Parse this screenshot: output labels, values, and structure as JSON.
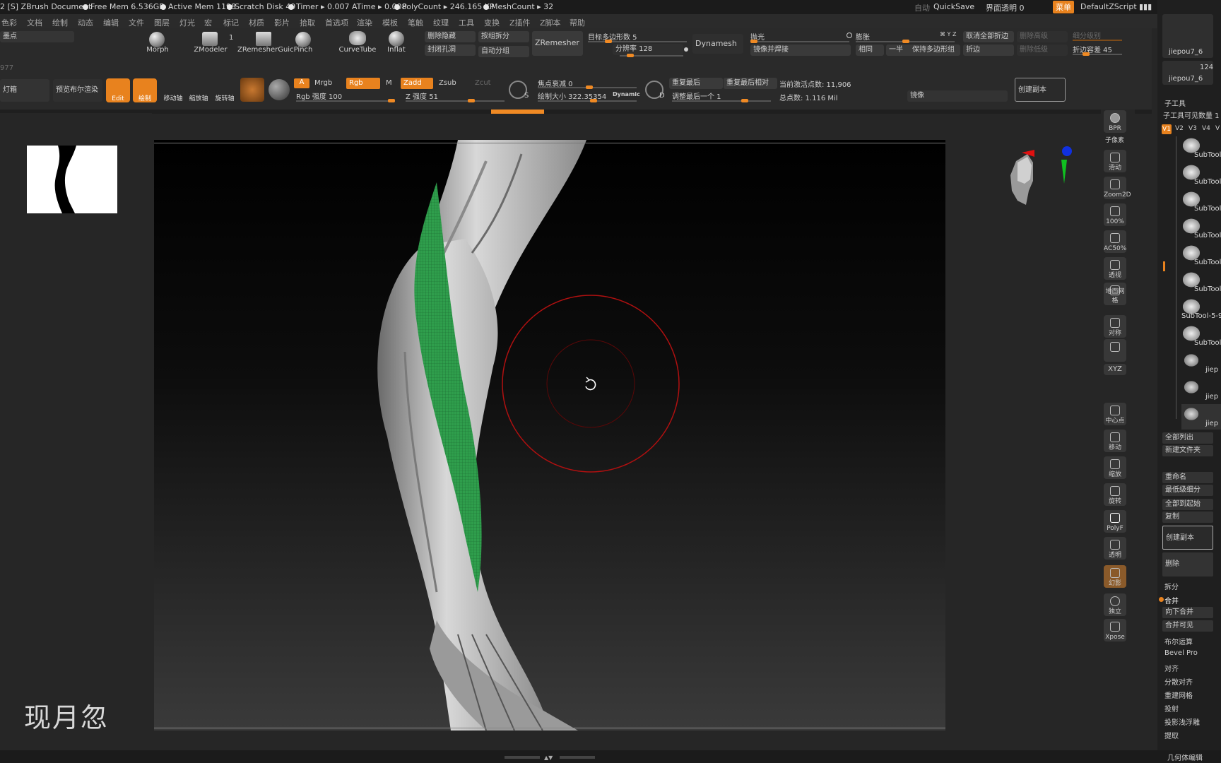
{
  "titlebar": {
    "left": "2 [S]  ZBrush Document",
    "free_mem": "Free Mem 6.536GB",
    "active_mem": "Active Mem 1198",
    "scratch": "Scratch Disk 49",
    "timer": "Timer ▸ 0.007 ATime ▸ 0.008",
    "polycount": "PolyCount ▸ 246.165 KP",
    "meshcount": "MeshCount ▸ 32",
    "auto": "自动",
    "quicksave": "QuickSave",
    "ui_opacity": "界面透明 0",
    "menu": "菜单",
    "script": "DefaultZScript"
  },
  "menus": [
    "色彩",
    "文档",
    "绘制",
    "动态",
    "编辑",
    "文件",
    "图层",
    "灯光",
    "宏",
    "标记",
    "材质",
    "影片",
    "拾取",
    "首选项",
    "渲染",
    "模板",
    "笔触",
    "纹理",
    "工具",
    "变换",
    "Z插件",
    "Z脚本",
    "帮助"
  ],
  "toolbar": {
    "moxdian": "墨点",
    "num977": "977",
    "lightbox": "灯箱",
    "preview_bool": "预览布尔渲染",
    "brushes": [
      "Morph",
      "ZModeler",
      "ZRemesherGuic",
      "Pinch",
      "CurveTube",
      "Inflat"
    ],
    "zmodeler_count": "1",
    "del_hidden": "删除隐藏",
    "close_holes": "封闭孔洞",
    "group_split": "按组拆分",
    "auto_group": "自动分组",
    "zremesher": "ZRemesher",
    "target_poly": "目标多边形数 5",
    "resolution": "分辨率 128",
    "dynamesh": "Dynamesh",
    "polish": "抛光",
    "inflate": "膨胀",
    "xyz": "⌘ Y Z",
    "cancel_all_fold": "取消全部折边",
    "del_higher": "删除高级",
    "subdiv_level": "细分级别",
    "mirror_weld": "镜像并焊接",
    "same": "相同",
    "half": "一半",
    "keep_groups": "保持多边形组",
    "crease": "折边",
    "del_lower": "删除低级",
    "crease_tol": "折边容差 45",
    "edit": "Edit",
    "draw": "绘制",
    "move": "移动轴",
    "scale": "缩放轴",
    "rotate": "旋转轴",
    "a": "A",
    "mrgb": "Mrgb",
    "rgb": "Rgb",
    "m": "M",
    "zadd": "Zadd",
    "zsub": "Zsub",
    "zcut": "Zcut",
    "rgb_intensity": "Rgb 强度 100",
    "z_intensity": "Z 强度 51",
    "focal": "焦点衰减 0",
    "draw_size": "绘制大小 322.35354",
    "dynamic": "Dynamic",
    "redo_last": "重复最后",
    "redo_last_rel": "重复最后相对",
    "adjust_last": "调整最后一个 1",
    "active_points": "当前激活点数: 11,906",
    "total_points": "总点数: 1.116 Mil",
    "mirror": "镜像",
    "create_copy": "创建副本",
    "s": "S",
    "d": "D"
  },
  "right_shelf": [
    "BPR",
    "子像素",
    "滑动",
    "Zoom2D",
    "100%",
    "AC50%",
    "透视",
    "地面网格",
    "对称",
    "",
    "XYZ",
    "",
    "",
    "中心点",
    "移动",
    "缩放",
    "旋转",
    "PolyF",
    "透明",
    "幻影",
    "独立",
    "Xpose"
  ],
  "right_panel": {
    "top_thumb_1": "jiepou7_6",
    "top_thumb_2": "jiepou7_6",
    "top_count": "124",
    "subtool_title": "子工具",
    "visible_count": "子工具可见数量 1",
    "versions": [
      "V1",
      "V2",
      "V3",
      "V4",
      "V"
    ],
    "subtools": [
      "SubTool",
      "SubTool",
      "SubTool",
      "SubTool",
      "SubTool",
      "SubTool",
      "SubTool-5-9",
      "SubTool",
      "jiep",
      "jiep",
      "jiep"
    ],
    "actions": [
      "全部列出",
      "新建文件夹",
      "重命名",
      "最低级细分",
      "全部到起始",
      "复制",
      "创建副本",
      "删除"
    ],
    "sections": [
      "拆分",
      "合并",
      "向下合并",
      "合并可见",
      "布尔运算",
      "Bevel Pro",
      "对齐",
      "分散对齐",
      "重建网格",
      "投射",
      "投影浅浮雕",
      "提取"
    ],
    "bottom": "几何体编辑"
  },
  "watermark": "现月忽",
  "colors": {
    "accent": "#e8821e",
    "background": "#262626",
    "muscle_green": "#2e9d4a"
  }
}
